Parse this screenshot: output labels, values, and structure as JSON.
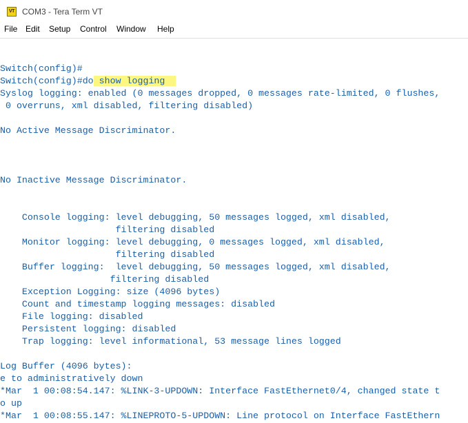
{
  "window": {
    "icon_text": "VT",
    "title": "COM3 - Tera Term VT"
  },
  "menu": {
    "items": [
      "File",
      "Edit",
      "Setup",
      "Control",
      "Window",
      "Help"
    ]
  },
  "terminal": {
    "text_color": "#1a5fa8",
    "highlight_color": "#fbf780",
    "lines": {
      "l0": "Switch(config)#",
      "l1_prompt": "Switch(config)#do",
      "l1_cmd": " show logging  ",
      "l2": "Syslog logging: enabled (0 messages dropped, 0 messages rate-limited, 0 flushes,",
      "l3": " 0 overruns, xml disabled, filtering disabled)",
      "l4": "No Active Message Discriminator.",
      "l5": "No Inactive Message Discriminator.",
      "l6": "    Console logging: level debugging, 50 messages logged, xml disabled,",
      "l7": "                     filtering disabled",
      "l8": "    Monitor logging: level debugging, 0 messages logged, xml disabled,",
      "l9": "                     filtering disabled",
      "l10": "    Buffer logging:  level debugging, 50 messages logged, xml disabled,",
      "l11": "                    filtering disabled",
      "l12": "    Exception Logging: size (4096 bytes)",
      "l13": "    Count and timestamp logging messages: disabled",
      "l14": "    File logging: disabled",
      "l15": "    Persistent logging: disabled",
      "l16": "    Trap logging: level informational, 53 message lines logged",
      "l17": "Log Buffer (4096 bytes):",
      "l18": "e to administratively down",
      "l19": "*Mar  1 00:08:54.147: %LINK-3-UPDOWN: Interface FastEthernet0/4, changed state t",
      "l20": "o up",
      "l21": "*Mar  1 00:08:55.147: %LINEPROTO-5-UPDOWN: Line protocol on Interface FastEthern"
    }
  }
}
